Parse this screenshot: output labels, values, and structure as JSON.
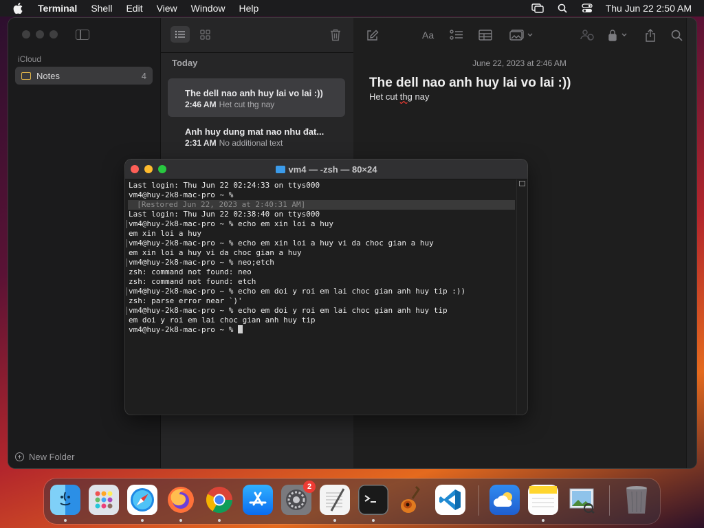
{
  "menubar": {
    "app_name": "Terminal",
    "menus": [
      "Shell",
      "Edit",
      "View",
      "Window",
      "Help"
    ],
    "clock": "Thu Jun 22  2:50 AM"
  },
  "notes": {
    "sidebar": {
      "section": "iCloud",
      "folder_name": "Notes",
      "folder_count": "4",
      "new_folder": "New Folder"
    },
    "list": {
      "group": "Today",
      "items": [
        {
          "title": "The dell nao anh huy lai vo lai :))",
          "time": "2:46 AM",
          "preview": "Het cut thg nay"
        },
        {
          "title": "Anh huy dung mat nao nhu đat...",
          "time": "2:31 AM",
          "preview": "No additional text"
        }
      ]
    },
    "editor": {
      "date": "June 22, 2023 at 2:46 AM",
      "title": "The dell nao anh huy lai vo lai :))",
      "body_before": "Het cut ",
      "body_underlined": "thg",
      "body_after": " nay",
      "toolbar_font": "Aa"
    }
  },
  "terminal": {
    "title": "vm4 — -zsh — 80×24",
    "lines": [
      "Last login: Thu Jun 22 02:24:33 on ttys000",
      "vm4@huy-2k8-mac-pro ~ %",
      "  [Restored Jun 22, 2023 at 2:40:31 AM]",
      "Last login: Thu Jun 22 02:38:40 on ttys000",
      "vm4@huy-2k8-mac-pro ~ % echo em xin loi a huy",
      "em xin loi a huy",
      "vm4@huy-2k8-mac-pro ~ % echo em xin loi a huy vi da choc gian a huy",
      "em xin loi a huy vi da choc gian a huy",
      "vm4@huy-2k8-mac-pro ~ % neo;etch",
      "zsh: command not found: neo",
      "zsh: command not found: etch",
      "vm4@huy-2k8-mac-pro ~ % echo em doi y roi em lai choc gian anh huy tip :))",
      "zsh: parse error near `)'",
      "vm4@huy-2k8-mac-pro ~ % echo em doi y roi em lai choc gian anh huy tip",
      "em doi y roi em lai choc gian anh huy tip",
      "vm4@huy-2k8-mac-pro ~ % "
    ]
  },
  "dock": {
    "apps": [
      "Finder",
      "Launchpad",
      "Safari",
      "Firefox",
      "Chrome",
      "App Store",
      "System Settings",
      "TextEdit",
      "Terminal",
      "GarageBand",
      "Visual Studio Code",
      "Weather",
      "Notes",
      "Preview",
      "Trash"
    ],
    "settings_badge": "2"
  }
}
